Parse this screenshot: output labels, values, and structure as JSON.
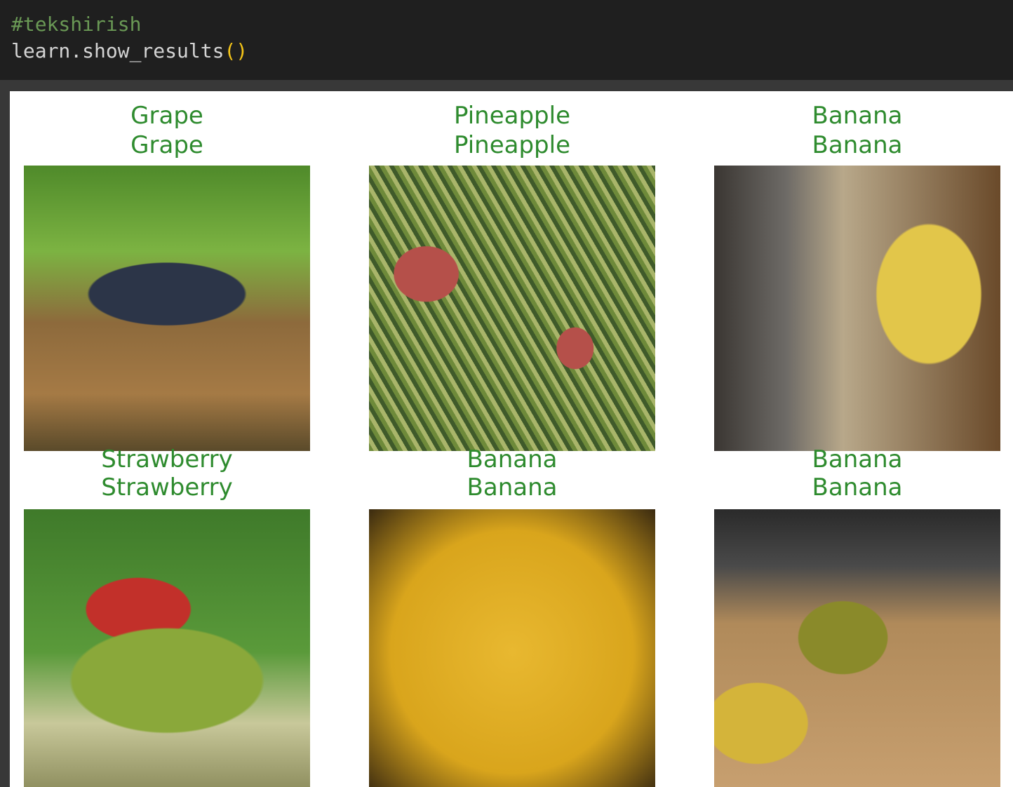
{
  "code": {
    "comment": "#tekshirish",
    "call": "learn.show_results",
    "parens": "()"
  },
  "results": [
    {
      "actual": "Grape",
      "predicted": "Grape",
      "image": "grape"
    },
    {
      "actual": "Pineapple",
      "predicted": "Pineapple",
      "image": "pine"
    },
    {
      "actual": "Banana",
      "predicted": "Banana",
      "image": "ban1"
    },
    {
      "actual": "Strawberry",
      "predicted": "Strawberry",
      "image": "straw"
    },
    {
      "actual": "Banana",
      "predicted": "Banana",
      "image": "ban2"
    },
    {
      "actual": "Banana",
      "predicted": "Banana",
      "image": "ban3"
    }
  ],
  "colors": {
    "label_correct": "#2e8b2e"
  }
}
